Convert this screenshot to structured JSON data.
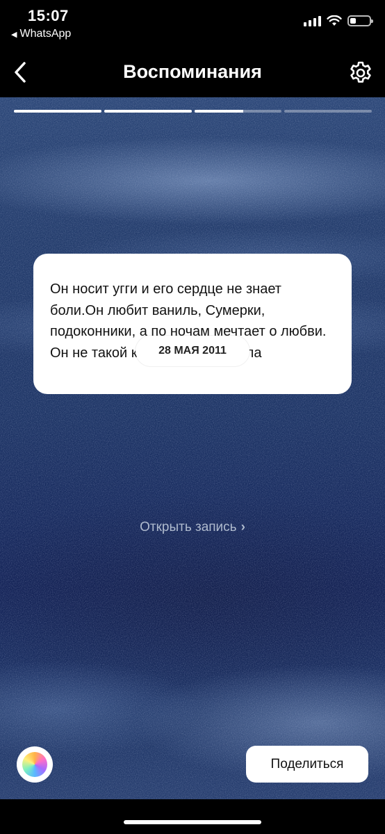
{
  "status_bar": {
    "time": "15:07",
    "back_app": "WhatsApp",
    "battery_level": 0.3
  },
  "header": {
    "title": "Воспоминания"
  },
  "story_progress": [
    1.0,
    1.0,
    0.56,
    0.0
  ],
  "memory": {
    "date": "28 МАЯ 2011",
    "text": "Он носит угги и его сердце не знает боли.Он любит ваниль, Сумерки, подоконники, а по ночам мечтает о любви. Он не такой как все. Он педрила"
  },
  "open_link": {
    "label": "Открыть запись",
    "icon": "chevron-right-icon"
  },
  "share_button": {
    "label": "Поделиться"
  },
  "icons": {
    "back": "chevron-left-icon",
    "settings": "gear-icon",
    "color": "color-wheel-icon"
  },
  "colors": {
    "background": "#000000",
    "story_blue": "#1e3566",
    "card": "#ffffff"
  }
}
